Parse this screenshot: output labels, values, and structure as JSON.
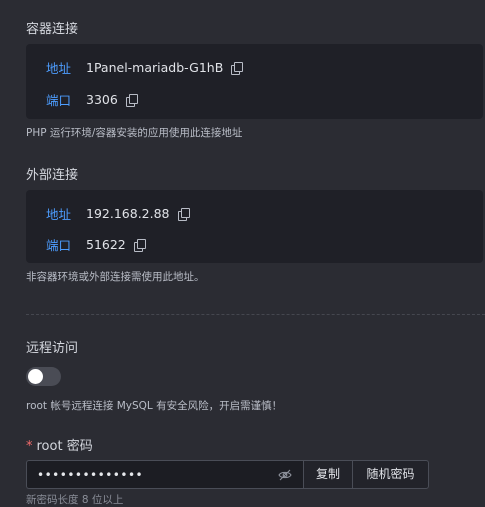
{
  "container_conn": {
    "title": "容器连接",
    "address_label": "地址",
    "address_value": "1Panel-mariadb-G1hB",
    "port_label": "端口",
    "port_value": "3306",
    "note": "PHP 运行环境/容器安装的应用使用此连接地址"
  },
  "external_conn": {
    "title": "外部连接",
    "address_label": "地址",
    "address_value": "192.168.2.88",
    "port_label": "端口",
    "port_value": "51622",
    "note": "非容器环境或外部连接需使用此地址。"
  },
  "remote": {
    "title": "远程访问",
    "enabled": false,
    "note": "root 帐号远程连接 MySQL 有安全风险，开启需谨慎！"
  },
  "root_password": {
    "required_mark": "*",
    "label": "root 密码",
    "value": "••••••••••••••",
    "copy_button": "复制",
    "random_button": "随机密码",
    "hint_partial": "新密码长度 8 位以上"
  },
  "colors": {
    "accent": "#4d9dff",
    "background": "#2b2c33",
    "panel": "#1f2027",
    "required": "#f56c6c"
  }
}
